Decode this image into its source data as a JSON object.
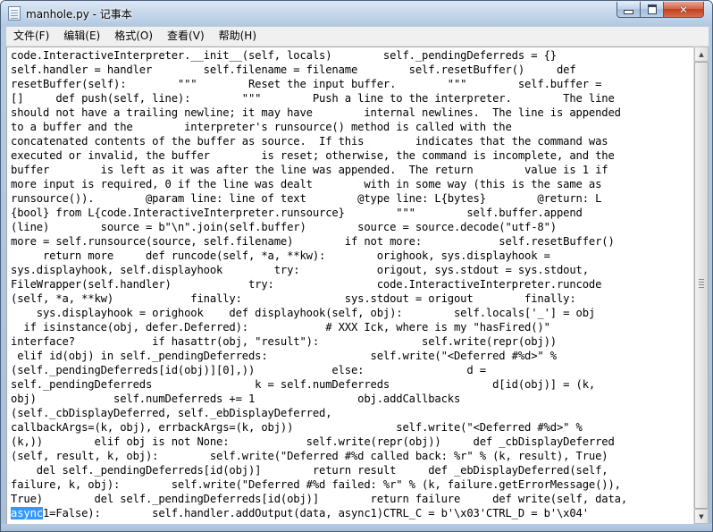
{
  "window": {
    "title": "manhole.py - 记事本",
    "app_icon": "notepad-icon",
    "controls": {
      "minimize_icon": "minimize-icon",
      "maximize_icon": "maximize-icon",
      "close_icon": "close-icon",
      "close_glyph": "✕"
    }
  },
  "menu": {
    "items": [
      {
        "label": "文件(F)"
      },
      {
        "label": "编辑(E)"
      },
      {
        "label": "格式(O)"
      },
      {
        "label": "查看(V)"
      },
      {
        "label": "帮助(H)"
      }
    ]
  },
  "editor": {
    "lines": [
      "code.InteractiveInterpreter.__init__(self, locals)        self._pendingDeferreds = {}",
      "self.handler = handler        self.filename = filename        self.resetBuffer()     def",
      "resetBuffer(self):        \"\"\"        Reset the input buffer.        \"\"\"        self.buffer =",
      "[]     def push(self, line):        \"\"\"        Push a line to the interpreter.        The line",
      "should not have a trailing newline; it may have        internal newlines.  The line is appended",
      "to a buffer and the        interpreter's runsource() method is called with the",
      "concatenated contents of the buffer as source.  If this        indicates that the command was",
      "executed or invalid, the buffer        is reset; otherwise, the command is incomplete, and the",
      "buffer        is left as it was after the line was appended.  The return        value is 1 if",
      "more input is required, 0 if the line was dealt        with in some way (this is the same as",
      "runsource()).        @param line: line of text        @type line: L{bytes}        @return: L",
      "{bool} from L{code.InteractiveInterpreter.runsource}        \"\"\"        self.buffer.append",
      "(line)        source = b\"\\n\".join(self.buffer)        source = source.decode(\"utf-8\")",
      "more = self.runsource(source, self.filename)        if not more:            self.resetBuffer()",
      "     return more     def runcode(self, *a, **kw):        orighook, sys.displayhook =",
      "sys.displayhook, self.displayhook        try:            origout, sys.stdout = sys.stdout,",
      "FileWrapper(self.handler)            try:                code.InteractiveInterpreter.runcode",
      "(self, *a, **kw)            finally:                sys.stdout = origout        finally:",
      "    sys.displayhook = orighook    def displayhook(self, obj):        self.locals['_'] = obj",
      "  if isinstance(obj, defer.Deferred):            # XXX Ick, where is my \"hasFired()\"",
      "interface?            if hasattr(obj, \"result\"):                self.write(repr(obj))",
      " elif id(obj) in self._pendingDeferreds:                self.write(\"<Deferred #%d>\" %",
      "(self._pendingDeferreds[id(obj)][0],))            else:                d =",
      "self._pendingDeferreds                k = self.numDeferreds                d[id(obj)] = (k,",
      "obj)            self.numDeferreds += 1                obj.addCallbacks",
      "(self._cbDisplayDeferred, self._ebDisplayDeferred,",
      "callbackArgs=(k, obj), errbackArgs=(k, obj))                self.write(\"<Deferred #%d>\" %",
      "(k,))        elif obj is not None:            self.write(repr(obj))     def _cbDisplayDeferred",
      "(self, result, k, obj):        self.write(\"Deferred #%d called back: %r\" % (k, result), True)",
      "    del self._pendingDeferreds[id(obj)]        return result     def _ebDisplayDeferred(self,",
      "failure, k, obj):        self.write(\"Deferred #%d failed: %r\" % (k, failure.getErrorMessage()),",
      "True)        del self._pendingDeferreds[id(obj)]        return failure     def write(self, data,"
    ],
    "last_line": {
      "selected": "async",
      "rest": "1=False):        self.handler.addOutput(data, async1)CTRL_C = b'\\x03'CTRL_D = b'\\x04'"
    }
  },
  "scrollbar": {
    "up_icon": "scroll-up-arrow-icon",
    "down_icon": "scroll-down-arrow-icon",
    "up_glyph": "▲",
    "down_glyph": "▼",
    "thumb_fraction": 0.97
  }
}
